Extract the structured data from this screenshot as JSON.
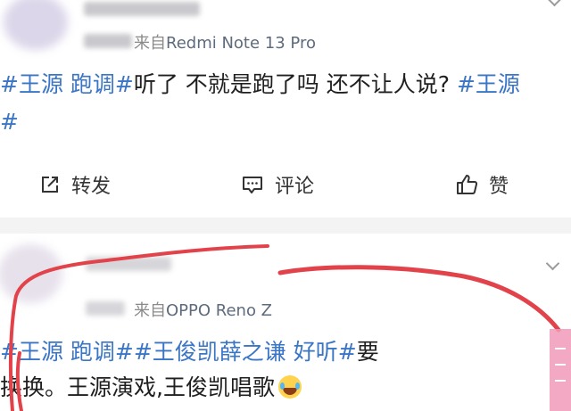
{
  "posts": [
    {
      "source_prefix": "来自",
      "device": "Redmi Note 13 Pro",
      "text_segments": [
        {
          "text": "#王源 跑调#",
          "tag": true
        },
        {
          "text": "听了 不就是跑了吗 还不让人说? ",
          "tag": false
        },
        {
          "text": "#王源",
          "tag": true
        }
      ],
      "text_line2": "#",
      "actions": {
        "repost": "转发",
        "comment": "评论",
        "like": "赞"
      }
    },
    {
      "source_prefix": "来自",
      "device": "OPPO Reno Z",
      "line1_segments": [
        {
          "text": "#王源 跑调#",
          "tag": true
        },
        {
          "text": "#王俊凯薛之谦 好听#",
          "tag": true
        },
        {
          "text": "要",
          "tag": false
        }
      ],
      "line2_text": "换换。王源演戏,王俊凯唱歌"
    }
  ],
  "icons": {
    "more": "chevron-down-icon",
    "repost": "share-icon",
    "comment": "comment-icon",
    "like": "thumbs-up-icon",
    "emoji": "laughing-tears-emoji"
  },
  "colors": {
    "tag": "#3b76c6",
    "annotation": "#e2424a"
  }
}
